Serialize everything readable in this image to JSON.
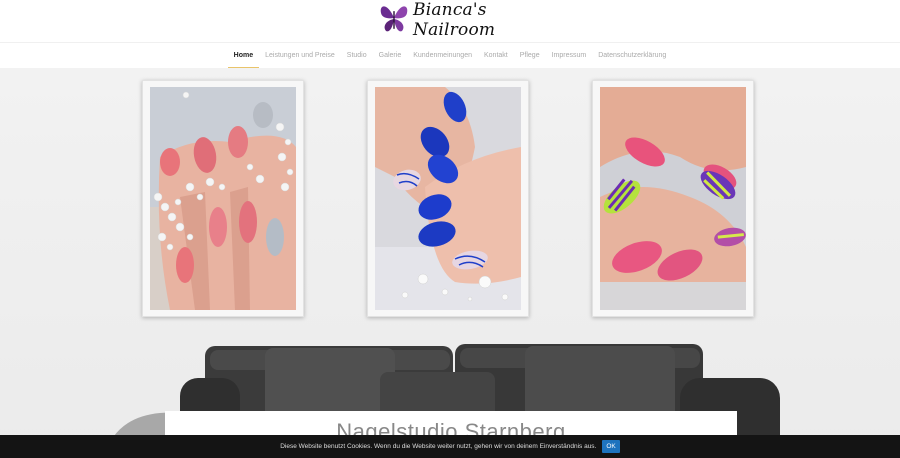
{
  "logo": {
    "text": "Bianca's Nailroom",
    "icon": "butterfly-icon"
  },
  "nav": {
    "items": [
      {
        "label": "Home",
        "active": true
      },
      {
        "label": "Leistungen und Preise",
        "active": false
      },
      {
        "label": "Studio",
        "active": false
      },
      {
        "label": "Galerie",
        "active": false
      },
      {
        "label": "Kundenmeinungen",
        "active": false
      },
      {
        "label": "Kontakt",
        "active": false
      },
      {
        "label": "Pflege",
        "active": false
      },
      {
        "label": "Impressum",
        "active": false
      },
      {
        "label": "Datenschutzerklärung",
        "active": false
      }
    ]
  },
  "hero": {
    "intro_title": "Nagelstudio Starnberg"
  },
  "cookie": {
    "text": "Diese Website benutzt Cookies. Wenn du die Website weiter nutzt, gehen wir von deinem Einverständnis aus.",
    "ok_label": "OK"
  },
  "colors": {
    "accent": "#e9c46a",
    "cookie_button": "#1e73be",
    "logo_purple": "#6a2c91"
  }
}
